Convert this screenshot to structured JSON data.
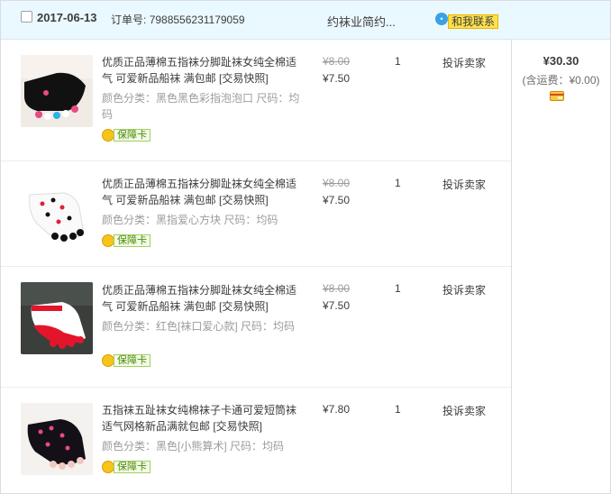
{
  "order": {
    "date": "2017-06-13",
    "order_no_label": "订单号:",
    "order_no": "7988556231179059",
    "shop": "约袜业简约...",
    "contact_label": "和我联系",
    "total": "¥30.30",
    "shipping_note": "(含运费：¥0.00)"
  },
  "items": [
    {
      "title": "优质正品薄棉五指袜分脚趾袜女纯全棉适气 可爱新品船袜 满包邮 [交易快照]",
      "sku": "颜色分类：黑色黑色彩指泡泡口  尺码：均码",
      "badge": "保障卡",
      "orig_price": "¥8.00",
      "price": "¥7.50",
      "qty": "1",
      "complaint": "投诉卖家"
    },
    {
      "title": "优质正品薄棉五指袜分脚趾袜女纯全棉适气 可爱新品船袜 满包邮 [交易快照]",
      "sku": "颜色分类：黑指爱心方块  尺码：均码",
      "badge": "保障卡",
      "orig_price": "¥8.00",
      "price": "¥7.50",
      "qty": "1",
      "complaint": "投诉卖家"
    },
    {
      "title": "优质正品薄棉五指袜分脚趾袜女纯全棉适气 可爱新品船袜 满包邮 [交易快照]",
      "sku": "颜色分类：红色[袜口爱心款]  尺码：均码",
      "badge": "保障卡",
      "orig_price": "¥8.00",
      "price": "¥7.50",
      "qty": "1",
      "complaint": "投诉卖家"
    },
    {
      "title": "五指袜五趾袜女纯棉袜子卡通可爱短筒袜适气网格新品满就包邮 [交易快照]",
      "sku": "颜色分类：黑色[小熊算术]  尺码：均码",
      "badge": "保障卡",
      "price": "¥7.80",
      "qty": "1",
      "complaint": "投诉卖家"
    }
  ],
  "colors": {
    "header_bg": "#eaf8ff",
    "badge_green": "#4b8a0c",
    "contact_yellow": "#ffe14d"
  },
  "icons": [
    "checkbox",
    "chat-bubble-icon",
    "shield-badge-icon",
    "card-icon"
  ]
}
